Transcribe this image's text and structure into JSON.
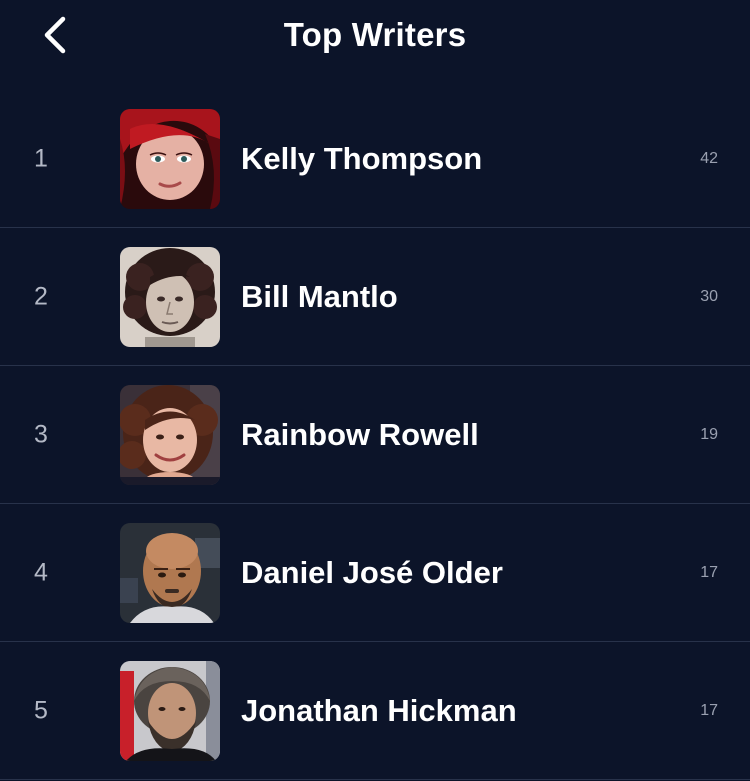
{
  "header": {
    "title": "Top Writers",
    "back_icon": "chevron-left-icon"
  },
  "colors": {
    "background": "#0c1429",
    "divider": "#28324a",
    "primary_text": "#ffffff",
    "muted_text": "#b4b9c6"
  },
  "writers": [
    {
      "rank": "1",
      "name": "Kelly Thompson",
      "count": "42"
    },
    {
      "rank": "2",
      "name": "Bill Mantlo",
      "count": "30"
    },
    {
      "rank": "3",
      "name": "Rainbow Rowell",
      "count": "19"
    },
    {
      "rank": "4",
      "name": "Daniel José Older",
      "count": "17"
    },
    {
      "rank": "5",
      "name": "Jonathan Hickman",
      "count": "17"
    }
  ]
}
